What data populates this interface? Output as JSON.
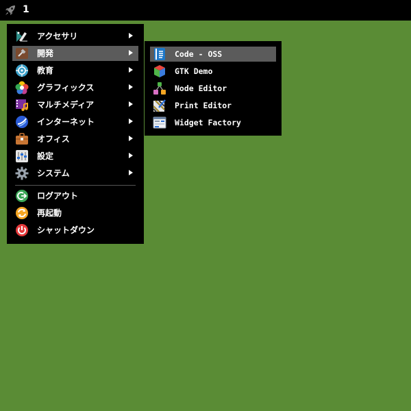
{
  "topbar": {
    "launcher_icon": "rocket-icon",
    "workspace_number": "1"
  },
  "main_menu": {
    "items": [
      {
        "label": "アクセサリ",
        "icon": "accessories-icon",
        "has_submenu": true
      },
      {
        "label": "開発",
        "icon": "development-icon",
        "has_submenu": true,
        "highlighted": true
      },
      {
        "label": "教育",
        "icon": "education-icon",
        "has_submenu": true
      },
      {
        "label": "グラフィックス",
        "icon": "graphics-icon",
        "has_submenu": true
      },
      {
        "label": "マルチメディア",
        "icon": "multimedia-icon",
        "has_submenu": true
      },
      {
        "label": "インターネット",
        "icon": "internet-icon",
        "has_submenu": true
      },
      {
        "label": "オフィス",
        "icon": "office-icon",
        "has_submenu": true
      },
      {
        "label": "設定",
        "icon": "settings-icon",
        "has_submenu": true
      },
      {
        "label": "システム",
        "icon": "system-icon",
        "has_submenu": true
      }
    ],
    "actions": [
      {
        "label": "ログアウト",
        "icon": "logout-icon"
      },
      {
        "label": "再起動",
        "icon": "restart-icon"
      },
      {
        "label": "シャットダウン",
        "icon": "shutdown-icon"
      }
    ]
  },
  "sub_menu": {
    "items": [
      {
        "label": "Code - OSS",
        "icon": "code-oss-icon",
        "highlighted": true
      },
      {
        "label": "GTK Demo",
        "icon": "gtk-demo-icon"
      },
      {
        "label": "Node Editor",
        "icon": "node-editor-icon"
      },
      {
        "label": "Print Editor",
        "icon": "print-editor-icon"
      },
      {
        "label": "Widget Factory",
        "icon": "widget-factory-icon"
      }
    ]
  },
  "colors": {
    "desktop_background": "#5a8c35",
    "menu_background": "#000000",
    "highlight": "#5b5b5b"
  }
}
